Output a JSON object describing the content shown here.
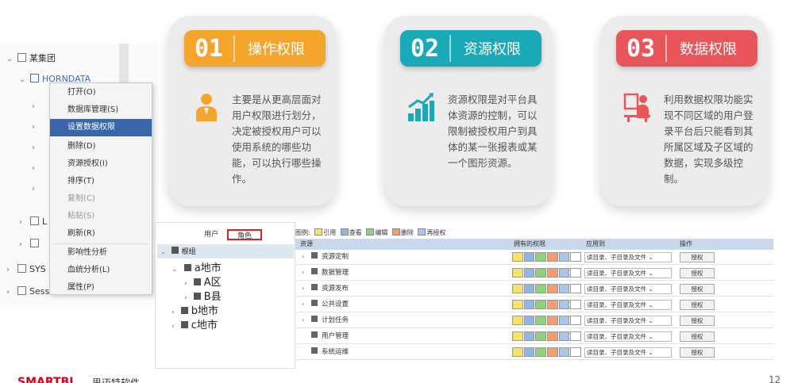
{
  "tree": {
    "root_label": "某集团",
    "db_label": "HORNDATA",
    "item_l_label": "L",
    "sys_label": "SYS",
    "sess_label": "Sess"
  },
  "context_menu": {
    "items": [
      {
        "label": "打开(O)",
        "state": "normal"
      },
      {
        "label": "数据库管理(S)",
        "state": "normal"
      },
      {
        "label": "设置数据权限",
        "state": "selected"
      },
      {
        "label": "删除(D)",
        "state": "normal"
      },
      {
        "label": "资源授权(I)",
        "state": "normal"
      },
      {
        "label": "排序(T)",
        "state": "normal"
      },
      {
        "label": "复制(C)",
        "state": "disabled"
      },
      {
        "label": "粘贴(S)",
        "state": "disabled"
      },
      {
        "label": "刷新(R)",
        "state": "normal"
      },
      {
        "label": "影响性分析",
        "state": "normal"
      },
      {
        "label": "血统分析(L)",
        "state": "normal"
      },
      {
        "label": "属性(P)",
        "state": "normal"
      }
    ]
  },
  "cards": [
    {
      "num": "01",
      "title": "操作权限",
      "color": "#f6a52c",
      "icon": "person-at-desk-icon",
      "text": "主要是从更高层面对用户权限进行划分，决定被授权用户可以使用系统的哪些功能，可以执行哪些操作。"
    },
    {
      "num": "02",
      "title": "资源权限",
      "color": "#1aa9b6",
      "icon": "growth-chart-icon",
      "text": "资源权限是对平台具体资源的控制，可以限制被授权用户到具体的某一张报表或某一个图形资源。"
    },
    {
      "num": "03",
      "title": "数据权限",
      "color": "#e8555a",
      "icon": "person-on-computer-icon",
      "text": "利用数据权限功能实现不同区域的用户登录平台后只能看到其所属区域及子区域的数据，实现多级控制。"
    }
  ],
  "roles": {
    "tabs": [
      "用户",
      "角色"
    ],
    "root": "根组",
    "items": [
      "a地市",
      "A区",
      "B县",
      "b地市",
      "c地市"
    ]
  },
  "grid": {
    "legend": {
      "label": "图例:",
      "items": [
        "引用",
        "查看",
        "编辑",
        "删除",
        "再授权"
      ]
    },
    "headers": [
      "资源",
      "拥有的权限",
      "应用到",
      "操作"
    ],
    "rows": [
      {
        "name": "资源定制",
        "expand": "›"
      },
      {
        "name": "数据管理",
        "expand": "›"
      },
      {
        "name": "资源发布",
        "expand": "›"
      },
      {
        "name": "公共设置",
        "expand": "›"
      },
      {
        "name": "计划任务",
        "expand": "›"
      },
      {
        "name": "用户管理",
        "expand": ""
      },
      {
        "name": "系统运维",
        "expand": ""
      }
    ],
    "apply_value": "读目录、子目录及文件",
    "grant_label": "授权"
  },
  "colors": {
    "quote": "#f3e36b",
    "view": "#8fb6e0",
    "edit": "#8fd17c",
    "delete": "#f0a070",
    "regrant": "#a7c7ee"
  },
  "footer": {
    "logo": "SMARTBI",
    "name": "思迈特软件",
    "page": "12"
  }
}
